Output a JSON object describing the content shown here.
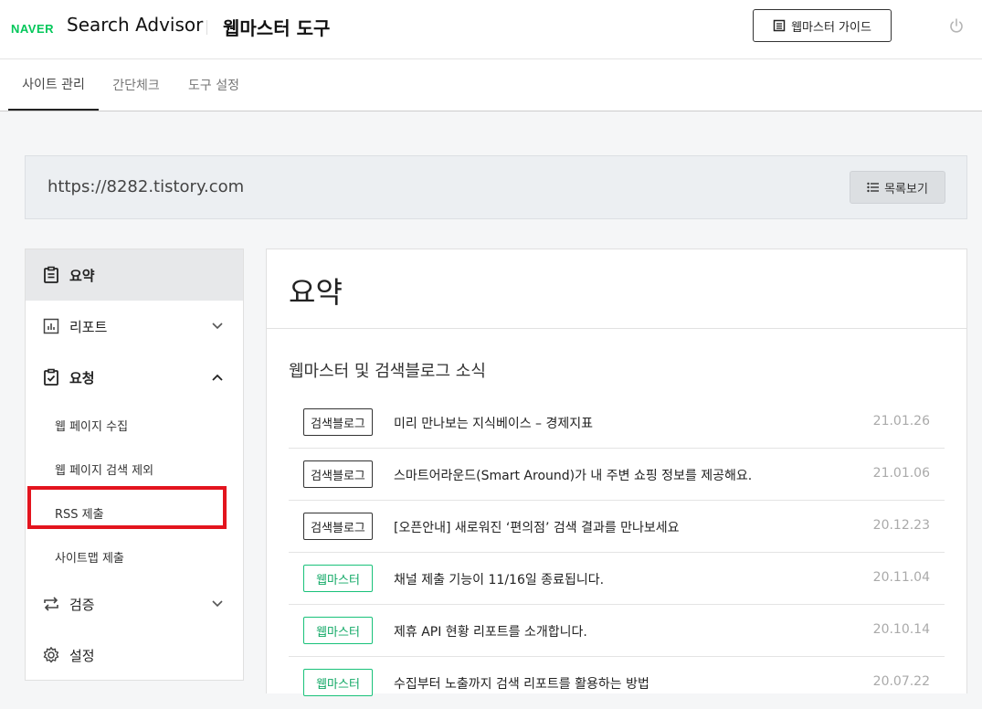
{
  "header": {
    "brand": "NAVER",
    "app_title": "Search Advisor",
    "tool_title": "웹마스터 도구",
    "guide_button": "웹마스터 가이드"
  },
  "tabs": [
    {
      "label": "사이트 관리",
      "active": true
    },
    {
      "label": "간단체크",
      "active": false
    },
    {
      "label": "도구 설정",
      "active": false
    }
  ],
  "site": {
    "url": "https://8282.tistory.com",
    "list_button": "목록보기"
  },
  "sidebar": {
    "items": [
      {
        "label": "요약",
        "icon": "clipboard-icon"
      },
      {
        "label": "리포트",
        "icon": "bar-chart-icon"
      },
      {
        "label": "요청",
        "icon": "clipboard-check-icon"
      },
      {
        "label": "검증",
        "icon": "repeat-icon"
      },
      {
        "label": "설정",
        "icon": "gear-icon"
      }
    ],
    "sub_items": [
      "웹 페이지 수집",
      "웹 페이지 검색 제외",
      "RSS 제출",
      "사이트맵 제출"
    ]
  },
  "main": {
    "title": "요약",
    "news_heading": "웹마스터 및 검색블로그 소식",
    "news": [
      {
        "badge": "검색블로그",
        "title": "미리 만나보는 지식베이스 – 경제지표",
        "date": "21.01.26"
      },
      {
        "badge": "검색블로그",
        "title": "스마트어라운드(Smart Around)가 내 주변 쇼핑 정보를 제공해요.",
        "date": "21.01.06"
      },
      {
        "badge": "검색블로그",
        "title": "[오픈안내] 새로워진 ‘편의점’ 검색 결과를 만나보세요",
        "date": "20.12.23"
      },
      {
        "badge": "웹마스터",
        "title": "채널 제출 기능이 11/16일 종료됩니다.",
        "date": "20.11.04"
      },
      {
        "badge": "웹마스터",
        "title": "제휴 API 현황 리포트를 소개합니다.",
        "date": "20.10.14"
      },
      {
        "badge": "웹마스터",
        "title": "수집부터 노출까지 검색 리포트를 활용하는 방법",
        "date": "20.07.22"
      }
    ]
  },
  "colors": {
    "brand_green": "#03c75a",
    "highlight_red": "#e3141e",
    "webmaster_badge": "#19c27a"
  }
}
